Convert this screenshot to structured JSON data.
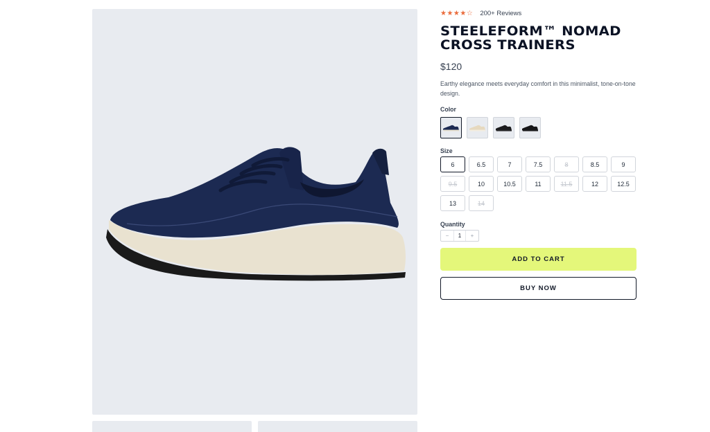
{
  "product": {
    "rating_stars": "★★★★☆",
    "reviews": "200+ Reviews",
    "title": "STEELEFORM™ NOMAD CROSS TRAINERS",
    "price": "$120",
    "description": "Earthy elegance meets everyday comfort in this minimalist, tone-on-tone design."
  },
  "color": {
    "label": "Color",
    "swatches": [
      {
        "name": "navy",
        "upper": "#1c2a52",
        "sole": "#e9e2d0"
      },
      {
        "name": "cream",
        "upper": "#e6d9bf",
        "sole": "#f3ede0"
      },
      {
        "name": "black-sole-dark",
        "upper": "#1b1b1d",
        "sole": "#2a2a2c"
      },
      {
        "name": "black",
        "upper": "#151517",
        "sole": "#1f1f21"
      }
    ]
  },
  "size": {
    "label": "Size",
    "options": [
      {
        "value": "6",
        "state": "selected"
      },
      {
        "value": "6.5",
        "state": "available"
      },
      {
        "value": "7",
        "state": "available"
      },
      {
        "value": "7.5",
        "state": "available"
      },
      {
        "value": "8",
        "state": "disabled"
      },
      {
        "value": "8.5",
        "state": "available"
      },
      {
        "value": "9",
        "state": "available"
      },
      {
        "value": "9.5",
        "state": "disabled"
      },
      {
        "value": "10",
        "state": "available"
      },
      {
        "value": "10.5",
        "state": "available"
      },
      {
        "value": "11",
        "state": "available"
      },
      {
        "value": "11.5",
        "state": "disabled"
      },
      {
        "value": "12",
        "state": "available"
      },
      {
        "value": "12.5",
        "state": "available"
      },
      {
        "value": "13",
        "state": "available"
      },
      {
        "value": "14",
        "state": "disabled"
      }
    ]
  },
  "quantity": {
    "label": "Quantity",
    "minus": "−",
    "value": "1",
    "plus": "+"
  },
  "actions": {
    "add_to_cart": "ADD TO CART",
    "buy_now": "BUY NOW"
  },
  "colors": {
    "accent": "#e4f77a",
    "star": "#ea6b3b",
    "image_bg": "#e8ebf0",
    "shoe_upper": "#1c2a52",
    "shoe_sole": "#e9e2d0"
  }
}
